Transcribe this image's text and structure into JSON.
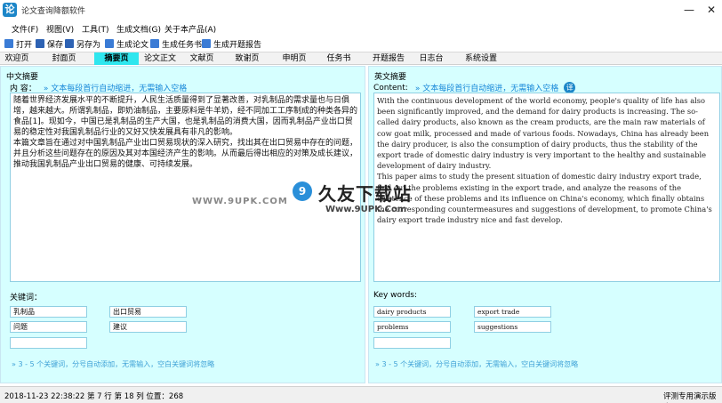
{
  "window": {
    "title": "论文查询降额软件",
    "icon_text": "论",
    "minimize": "—",
    "close": "✕"
  },
  "menu": [
    {
      "label": "文件(F)"
    },
    {
      "label": "视图(V)"
    },
    {
      "label": "工具(T)"
    },
    {
      "label": "生成文档(G)"
    },
    {
      "label": "关于本产品(A)"
    }
  ],
  "toolbar": [
    {
      "label": "打开",
      "icon": "open-folder-icon",
      "color": "#3a7bd5"
    },
    {
      "label": "保存",
      "icon": "save-disk-icon",
      "color": "#2d62b3"
    },
    {
      "label": "另存为",
      "icon": "save-as-icon",
      "color": "#2d62b3"
    },
    {
      "label": "生成论文",
      "icon": "document-icon",
      "color": "#3a7bd5"
    },
    {
      "label": "生成任务书",
      "icon": "document-icon",
      "color": "#3a7bd5"
    },
    {
      "label": "生成开题报告",
      "icon": "document-icon",
      "color": "#3a7bd5"
    }
  ],
  "tabs": [
    {
      "label": "欢迎页"
    },
    {
      "label": "封面页"
    },
    {
      "label": "摘要页",
      "active": true
    },
    {
      "label": "论文正文"
    },
    {
      "label": "文献页"
    },
    {
      "label": "致谢页"
    },
    {
      "label": "申明页"
    },
    {
      "label": "任务书"
    },
    {
      "label": "开题报告"
    },
    {
      "label": "日志台"
    },
    {
      "label": "系统设置"
    }
  ],
  "cn_abstract": {
    "title": "中文摘要",
    "content_label": "内  容：",
    "hint": "»  文本每段首行自动缩进，无需输入空格",
    "paragraphs": [
      "随着世界经济发展水平的不断提升，人民生活质量得到了显著改善，对乳制品的需求量也与日俱增，越来越大。所谓乳制品，即奶油制品，主要原料是牛羊奶，经不同加工工序制成的种类各异的食品[1]。现如今，中国已是乳制品的生产大国，也是乳制品的消费大国，因而乳制品产业出口贸易的稳定性对我国乳制品行业的又好又快发展具有非凡的影响。",
      "本篇文章旨在通过对中国乳制品产业出口贸易现状的深入研究，找出其在出口贸易中存在的问题，并且分析这些问题存在的原因及其对本国经济产生的影响。从而最后得出相应的对策及成长建议，推动我国乳制品产业出口贸易的健康、可持续发展。"
    ],
    "keywords_label": "关键词：",
    "keywords": [
      "乳制品",
      "出口贸易",
      "问题",
      "建议",
      ""
    ],
    "keywords_hint": "» 3 - 5 个关键词，分号自动添加，无需输入，空白关键词将忽略"
  },
  "en_abstract": {
    "title": "英文摘要",
    "content_label": "Content:",
    "hint": "»  文本每段首行自动缩进，无需输入空格",
    "translate_btn": "译",
    "paragraphs": [
      "With the continuous development of the world economy, people's quality of life has also been significantly improved, and the demand for dairy products is increasing. The so-called dairy products, also known as the cream products, are the main raw materials of cow goat milk, processed and made of various foods. Nowadays, China has already been the dairy producer, is also the consumption of dairy products, thus the stability of the export trade of domestic dairy industry is very important to the healthy and sustainable development of dairy industry.",
      "This paper aims to study the present situation of domestic dairy industry export trade, find out the problems existing in the export trade, and analyze the reasons of the existence of these problems and its influence on China's economy, which finally obtains the corresponding countermeasures and suggestions of development, to promote China's dairy export trade industry nice and fast develop."
    ],
    "keywords_label": "Key words:",
    "keywords": [
      "dairy products",
      "export trade",
      "problems",
      "suggestions",
      ""
    ],
    "keywords_hint": "» 3 - 5 个关键词，分号自动添加，无需输入，空白关键词将忽略"
  },
  "watermark": {
    "url_left": "WWW.9UPK.COM",
    "logo": "9",
    "cn_text": "久友下载站",
    "url_right": "Www.9UPK.Com"
  },
  "status": {
    "left": "2018-11-23 22:38:22  第 7 行 第 18 列 位置：268",
    "right": "评测专用演示版本"
  }
}
